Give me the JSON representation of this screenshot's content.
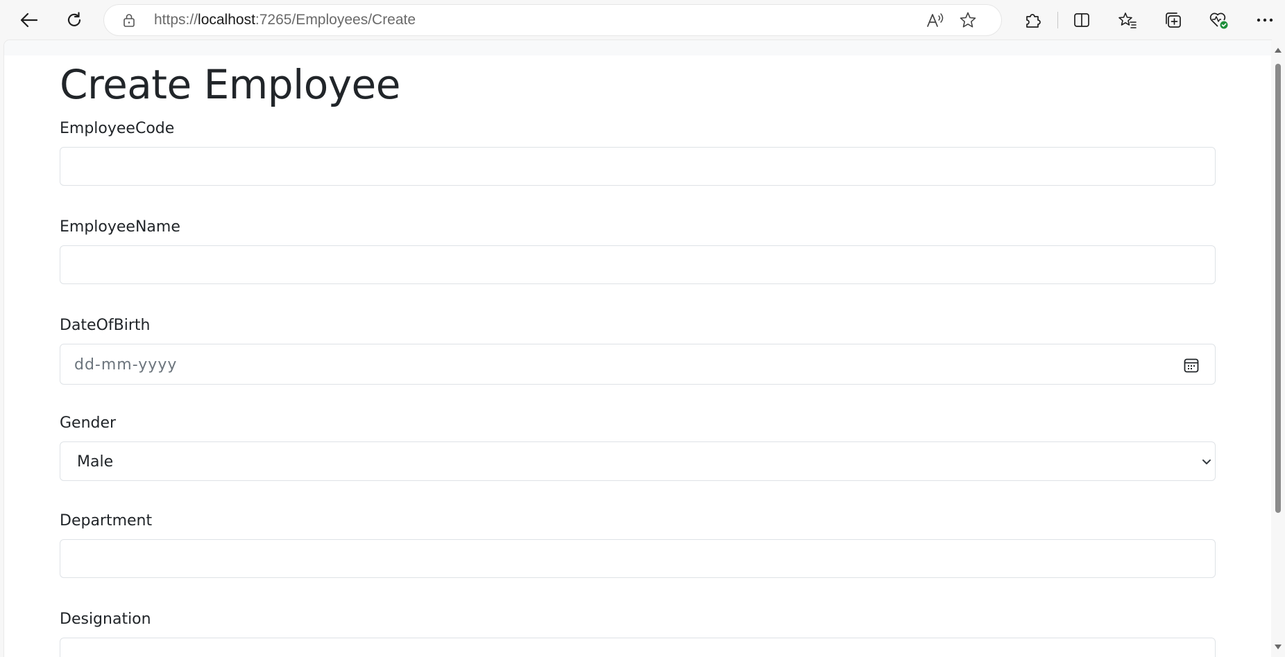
{
  "browser": {
    "url_prefix": "https://",
    "url_host": "localhost",
    "url_rest": ":7265/Employees/Create",
    "icons": {
      "back": "back-arrow-icon",
      "refresh": "refresh-icon",
      "lock": "lock-icon",
      "read_aloud": "read-aloud-icon",
      "favorite": "star-icon",
      "extensions": "puzzle-icon",
      "split_screen": "split-screen-icon",
      "favorites": "favorites-list-icon",
      "collections": "collections-icon",
      "browser_essentials": "heart-pulse-icon",
      "more": "more-dots-icon"
    }
  },
  "page": {
    "title": "Create Employee",
    "fields": {
      "employee_code": {
        "label": "EmployeeCode",
        "value": ""
      },
      "employee_name": {
        "label": "EmployeeName",
        "value": ""
      },
      "date_of_birth": {
        "label": "DateOfBirth",
        "placeholder": "dd-mm-yyyy"
      },
      "gender": {
        "label": "Gender",
        "selected": "Male"
      },
      "department": {
        "label": "Department",
        "value": ""
      },
      "designation": {
        "label": "Designation",
        "value": ""
      }
    }
  },
  "colors": {
    "text": "#212529",
    "border": "#dee2e6",
    "placeholder": "#6c757d",
    "chrome_bg": "#f7f7f7"
  }
}
